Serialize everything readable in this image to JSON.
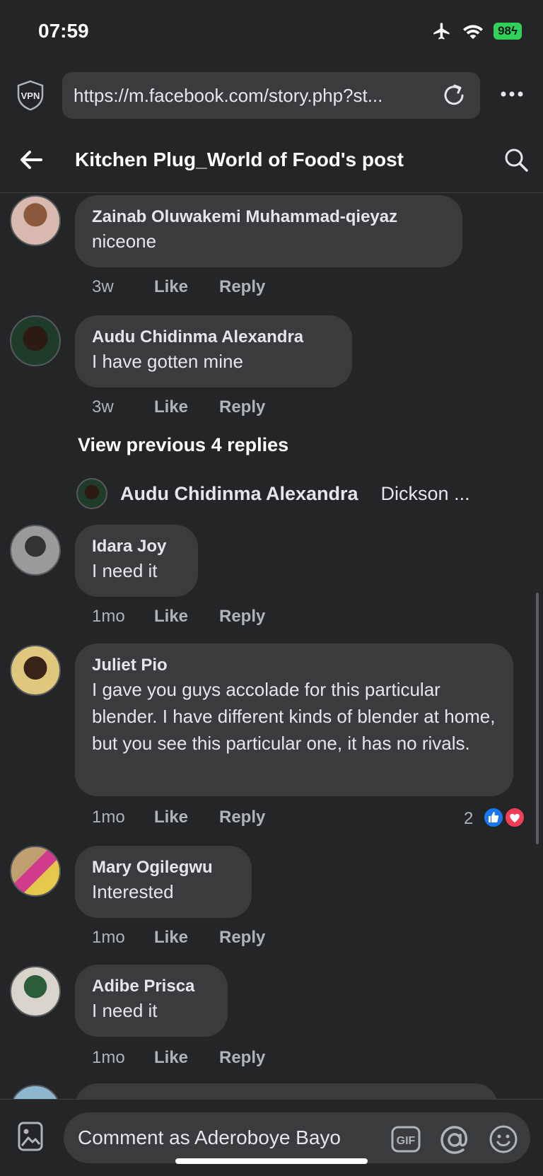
{
  "status_bar": {
    "time": "07:59",
    "battery": "98"
  },
  "browser": {
    "vpn_label": "VPN",
    "url": "https://m.facebook.com/story.php?st..."
  },
  "header": {
    "title": "Kitchen Plug_World of Food's post"
  },
  "comments": [
    {
      "author": "Zainab Oluwakemi Muhammad-qieyaz",
      "text": "niceone",
      "time": "3w",
      "like": "Like",
      "reply": "Reply"
    },
    {
      "author": "Audu Chidinma Alexandra",
      "text": "I have gotten mine",
      "time": "3w",
      "like": "Like",
      "reply": "Reply"
    },
    {
      "author": "Idara Joy",
      "text": "I need it",
      "time": "1mo",
      "like": "Like",
      "reply": "Reply"
    },
    {
      "author": "Juliet Pio",
      "text": "I gave you guys accolade for this particular blender. I have different kinds of blender at home, but you see this particular one, it has no rivals.",
      "time": "1mo",
      "like": "Like",
      "reply": "Reply",
      "reactions_count": "2"
    },
    {
      "author": "Mary Ogilegwu",
      "text": "Interested",
      "time": "1mo",
      "like": "Like",
      "reply": "Reply"
    },
    {
      "author": "Adibe Prisca",
      "text": "I need it",
      "time": "1mo",
      "like": "Like",
      "reply": "Reply"
    }
  ],
  "replies_thread": {
    "view_previous": "View previous 4 replies",
    "preview_author": "Audu Chidinma Alexandra",
    "preview_snippet": "Dickson ..."
  },
  "composer": {
    "placeholder": "Comment as Aderoboye Bayo",
    "gif_label": "GIF"
  },
  "colors": {
    "background": "#242526",
    "bubble": "#3a3b3c",
    "like_blue": "#1877f2",
    "love_red": "#f33e58",
    "battery_green": "#30d158"
  }
}
